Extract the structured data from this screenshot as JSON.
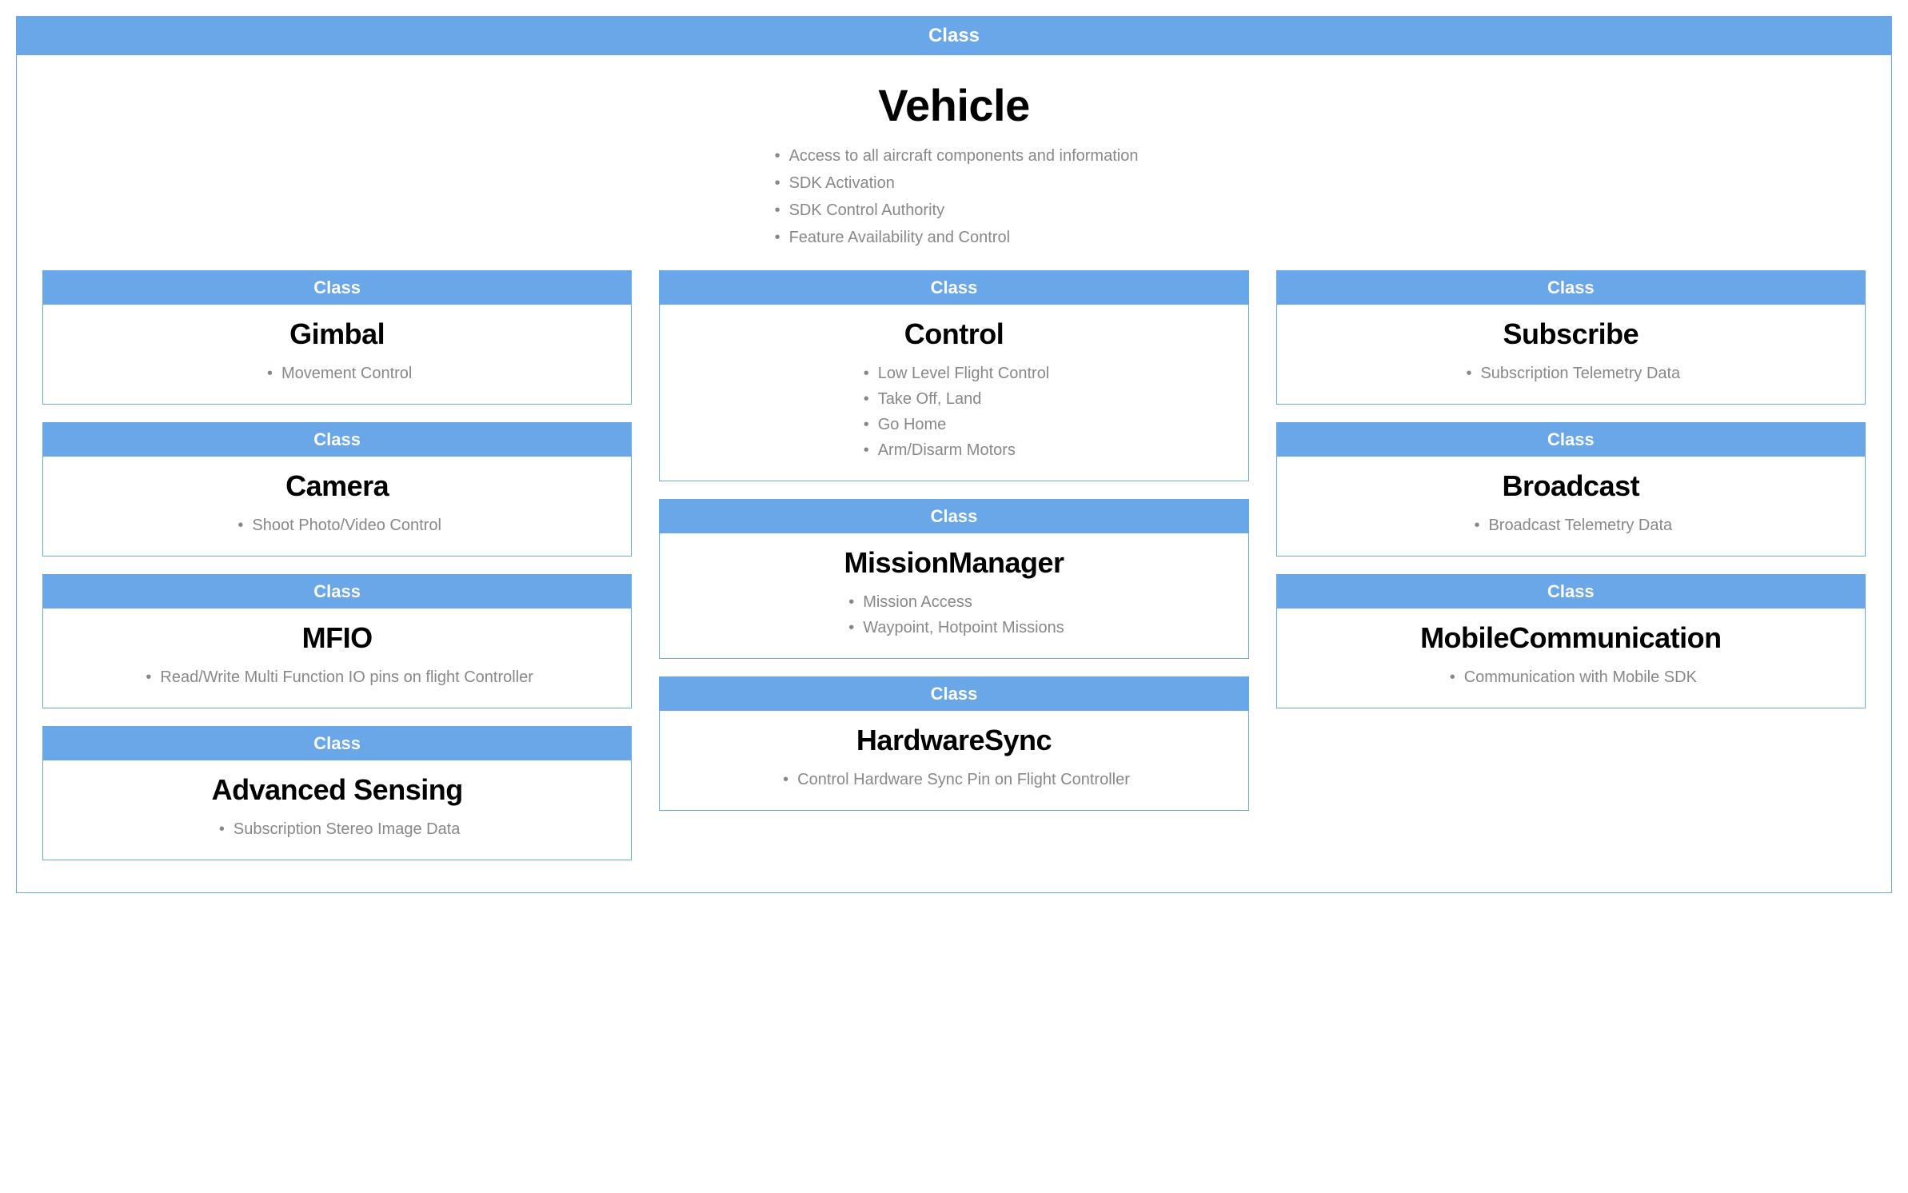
{
  "label": "Class",
  "vehicle": {
    "title": "Vehicle",
    "bullets": [
      "Access to all aircraft components and information",
      "SDK Activation",
      "SDK Control Authority",
      "Feature Availability and Control"
    ]
  },
  "columns": [
    [
      {
        "label": "Class",
        "title": "Gimbal",
        "bullets": [
          "Movement Control"
        ]
      },
      {
        "label": "Class",
        "title": "Camera",
        "bullets": [
          "Shoot Photo/Video Control"
        ]
      },
      {
        "label": "Class",
        "title": "MFIO",
        "bullets": [
          "Read/Write Multi Function IO pins on flight Controller"
        ]
      },
      {
        "label": "Class",
        "title": "Advanced Sensing",
        "bullets": [
          "Subscription Stereo Image Data"
        ]
      }
    ],
    [
      {
        "label": "Class",
        "title": "Control",
        "bullets": [
          "Low Level Flight Control",
          "Take Off, Land",
          "Go Home",
          "Arm/Disarm Motors"
        ]
      },
      {
        "label": "Class",
        "title": "MissionManager",
        "bullets": [
          "Mission Access",
          "Waypoint, Hotpoint Missions"
        ]
      },
      {
        "label": "Class",
        "title": "HardwareSync",
        "bullets": [
          "Control Hardware Sync Pin on Flight Controller"
        ]
      }
    ],
    [
      {
        "label": "Class",
        "title": "Subscribe",
        "bullets": [
          "Subscription Telemetry Data"
        ]
      },
      {
        "label": "Class",
        "title": "Broadcast",
        "bullets": [
          "Broadcast Telemetry Data"
        ]
      },
      {
        "label": "Class",
        "title": "MobileCommunication",
        "bullets": [
          "Communication with Mobile SDK"
        ]
      }
    ]
  ]
}
